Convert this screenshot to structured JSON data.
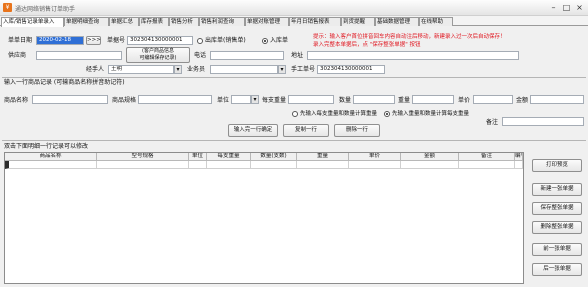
{
  "window": {
    "title": "通达网络销售订单助手"
  },
  "tabs": [
    "入库/销售记录单录入",
    "单据明细查询",
    "单据汇总",
    "库存报表",
    "销售分析",
    "销售利润查询",
    "单据对账管理",
    "年月日销售报表",
    "到货提醒",
    "基础数据管理",
    "在线帮助"
  ],
  "header": {
    "date_label": "单单日期",
    "date_value": "2020-02-18",
    "date_btn": ">>>",
    "doc_no_label": "单据号",
    "doc_no_value": "302304130000001",
    "radio_out": "出库单(销售单)",
    "radio_in": "入库单",
    "tip_line1": "提示：输入客户首位拼音回车内容自动注后移动，新建录入过一次后自动保存！",
    "tip_line2": "录入完整本单据后，点 \"保存整张单据\" 按钮",
    "supplier_label": "供应商",
    "customer_hint_line1": "(客户商品信息",
    "customer_hint_line2": "可编辑保存记录)",
    "phone_label": "电话",
    "address_label": "地址",
    "handler_label": "经手人",
    "handler_value": "王明",
    "salesman_label": "业务员",
    "manual_no_label": "手工单号",
    "manual_no_value": "302304130000001"
  },
  "item_entry": {
    "section_title": "输入一行商品记录 (可输商品名称拼音助记符)",
    "name_label": "商品名称",
    "spec_label": "商品规格",
    "unit_label": "单位",
    "unit_value": "",
    "per_weight_label": "每支重量",
    "qty_label": "数量",
    "weight_label": "重量",
    "price_label": "单价",
    "amount_label": "金额",
    "note_label": "备注",
    "radio_a": "先输入每支重量和数量计算重量",
    "radio_b": "先输入重量和数量计算每支重量",
    "confirm_btn": "输入完一行确定",
    "insert_btn": "复制一行",
    "delete_btn": "删除一行"
  },
  "grid": {
    "caption": "双击下面明细一行记录可以修改",
    "columns": [
      "商品名称",
      "型号规格",
      "单位",
      "每支重量",
      "数量(支数)",
      "重量",
      "单价",
      "金额",
      "备注",
      "编号"
    ]
  },
  "side_buttons": [
    "打印预览",
    "新建一张单据",
    "保存整张单据",
    "删除整张单据",
    "前一张单据",
    "后一张单据"
  ]
}
